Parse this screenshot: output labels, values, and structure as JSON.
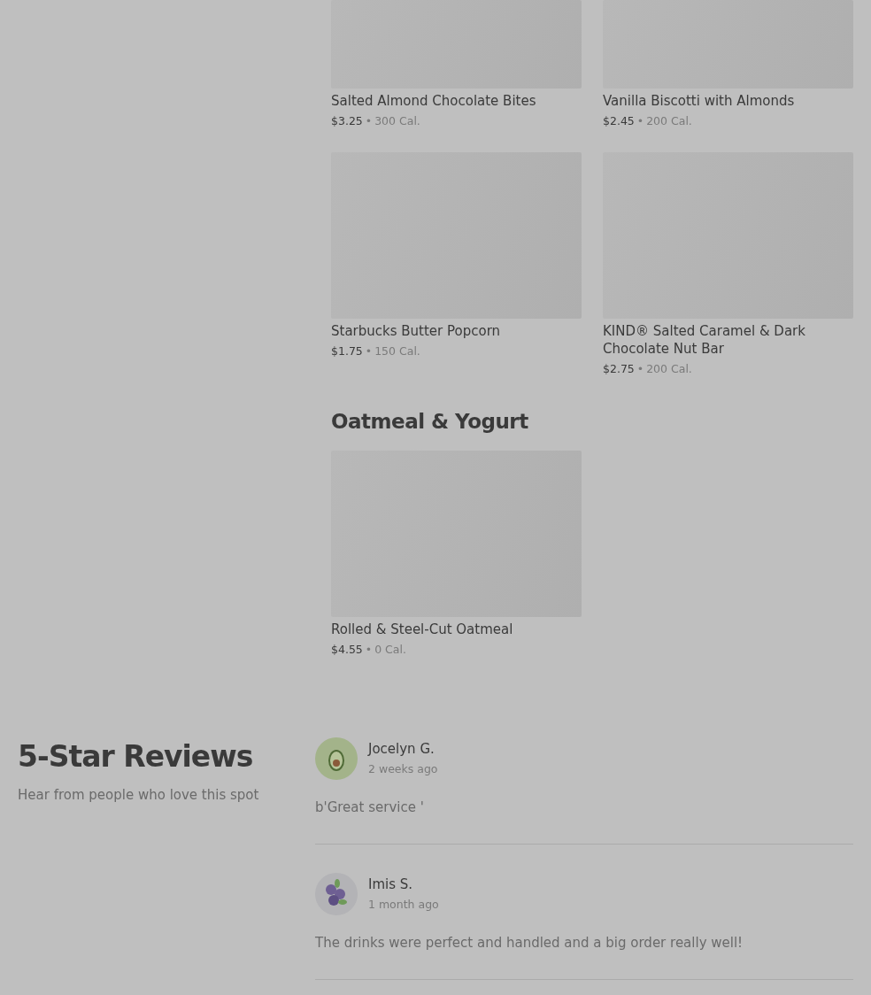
{
  "menu_sections": [
    {
      "items": [
        {
          "name": "Salted Almond Chocolate Bites",
          "price": "$3.25",
          "separator": "•",
          "calories": "300 Cal."
        },
        {
          "name": "Vanilla Biscotti with Almonds",
          "price": "$2.45",
          "separator": "•",
          "calories": "200 Cal."
        },
        {
          "name": "Starbucks Butter Popcorn",
          "price": "$1.75",
          "separator": "•",
          "calories": "150 Cal."
        },
        {
          "name": "KIND® Salted Caramel & Dark Chocolate Nut Bar",
          "price": "$2.75",
          "separator": "•",
          "calories": "200 Cal."
        }
      ]
    },
    {
      "title": "Oatmeal & Yogurt",
      "items": [
        {
          "name": "Rolled & Steel-Cut Oatmeal",
          "price": "$4.55",
          "separator": "•",
          "calories": "0 Cal."
        }
      ]
    }
  ],
  "reviews_section": {
    "title": "5-Star Reviews",
    "subtitle": "Hear from people who love this spot",
    "reviews": [
      {
        "author": "Jocelyn G.",
        "time": "2 weeks ago",
        "text": "b'Great service '",
        "kind": "avocado"
      },
      {
        "author": "Imis S.",
        "time": "1 month ago",
        "text": "The drinks were perfect and handled and a big order really well!",
        "kind": "berries"
      }
    ]
  }
}
